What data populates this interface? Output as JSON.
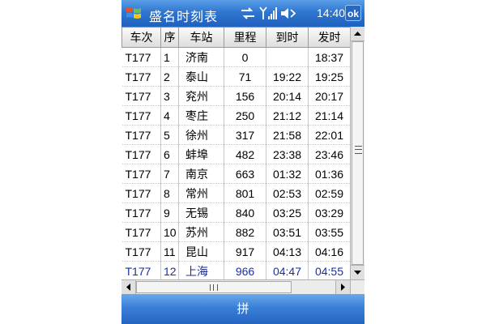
{
  "window": {
    "title": "盛名时刻表",
    "clock": "14:40",
    "ok_label": "ok"
  },
  "icons": {
    "start": "windows-flag-icon",
    "sync": "sync-arrows-icon",
    "signal": "signal-strength-icon",
    "volume": "speaker-volume-icon"
  },
  "table": {
    "columns": [
      "车次",
      "序",
      "车站",
      "里程",
      "到时",
      "发时"
    ],
    "rows": [
      [
        "T177",
        "1",
        "济南",
        "0",
        "",
        "18:37"
      ],
      [
        "T177",
        "2",
        "泰山",
        "71",
        "19:22",
        "19:25"
      ],
      [
        "T177",
        "3",
        "兖州",
        "156",
        "20:14",
        "20:17"
      ],
      [
        "T177",
        "4",
        "枣庄",
        "250",
        "21:12",
        "21:14"
      ],
      [
        "T177",
        "5",
        "徐州",
        "317",
        "21:58",
        "22:01"
      ],
      [
        "T177",
        "6",
        "蚌埠",
        "482",
        "23:38",
        "23:46"
      ],
      [
        "T177",
        "7",
        "南京",
        "663",
        "01:32",
        "01:36"
      ],
      [
        "T177",
        "8",
        "常州",
        "801",
        "02:53",
        "02:59"
      ],
      [
        "T177",
        "9",
        "无锡",
        "840",
        "03:25",
        "03:29"
      ],
      [
        "T177",
        "10",
        "苏州",
        "882",
        "03:51",
        "03:55"
      ],
      [
        "T177",
        "11",
        "昆山",
        "917",
        "04:13",
        "04:16"
      ],
      [
        "T177",
        "12",
        "上海",
        "966",
        "04:47",
        "04:55"
      ]
    ],
    "selected_row": 11
  },
  "menu": {
    "softkey_label": "拼"
  },
  "colors": {
    "titlebar": "#2f76d0",
    "menubar": "#3a80d6",
    "selected_text": "#1a2f9e"
  }
}
